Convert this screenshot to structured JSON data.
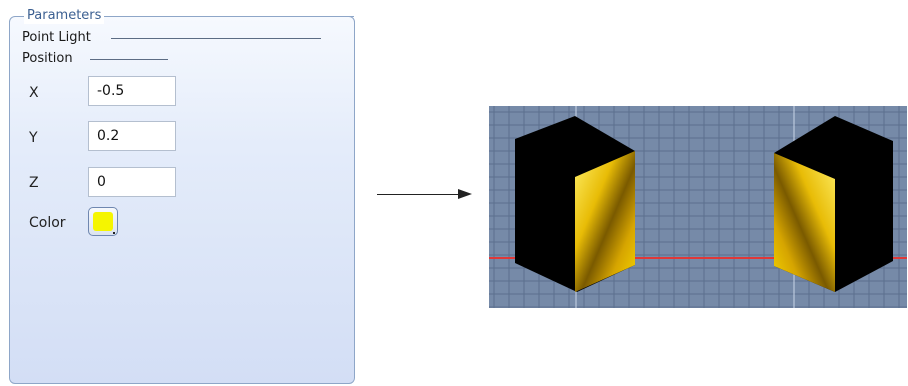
{
  "panel": {
    "title": "Parameters",
    "section_title": "Point Light",
    "subsection_title": "Position",
    "fields": [
      {
        "label": "X",
        "value": "-0.5"
      },
      {
        "label": "Y",
        "value": "0.2"
      },
      {
        "label": "Z",
        "value": "0"
      }
    ],
    "color_label": "Color",
    "color_value": "#f5f500"
  },
  "viewport": {
    "background": "#768aa8",
    "grid_color": "#5c6f8e",
    "axis_color": "#e03838",
    "cube_top_color": "#000000",
    "cube_face_color": "#e0b800"
  }
}
